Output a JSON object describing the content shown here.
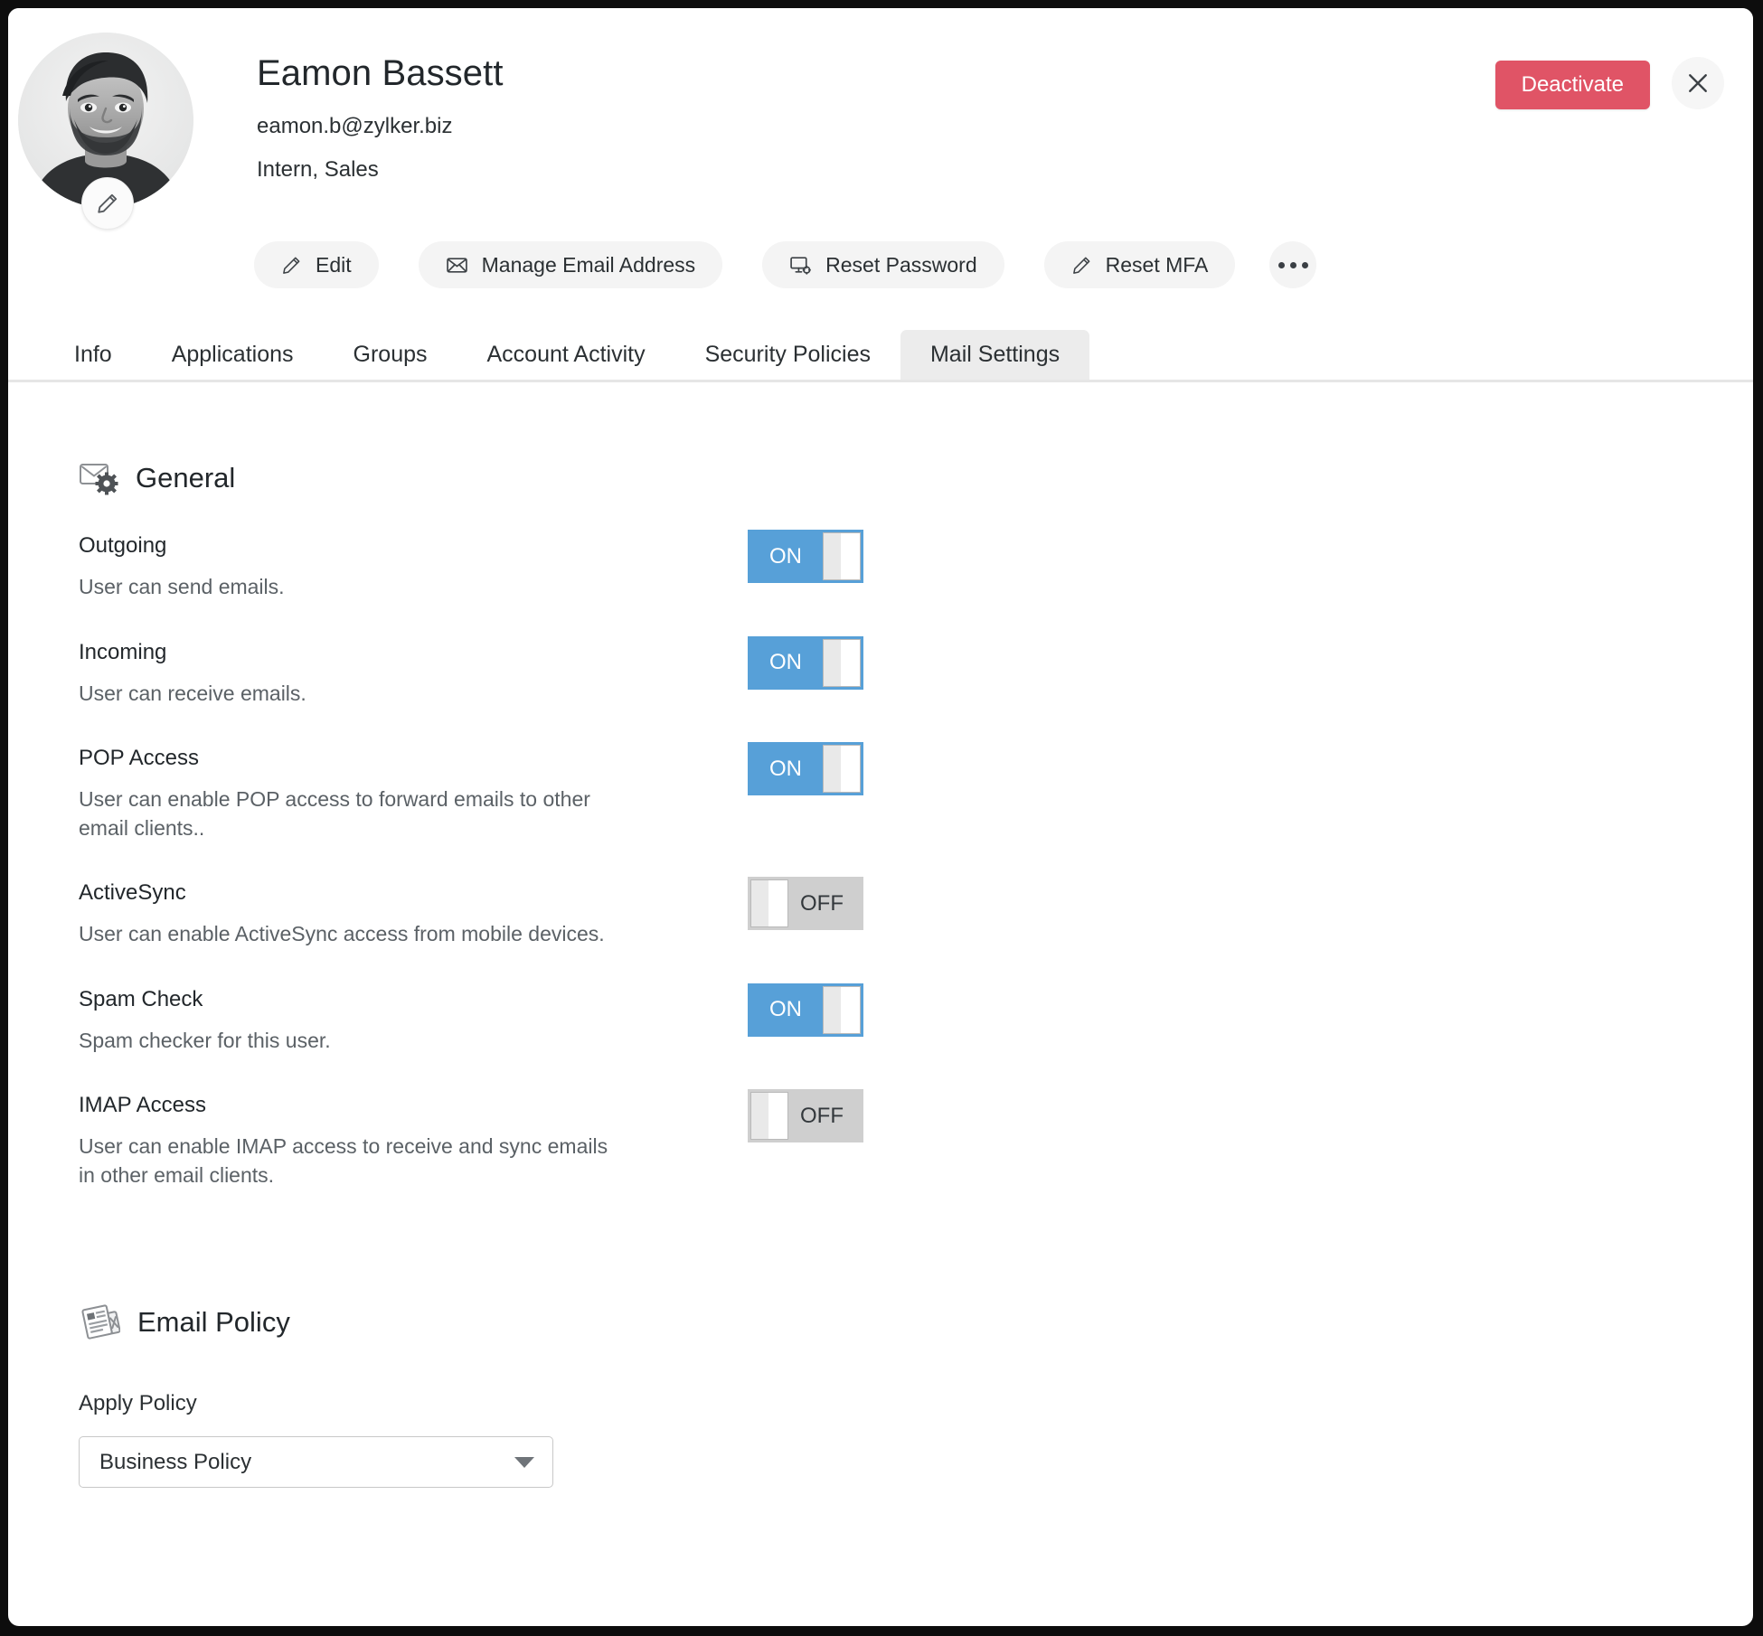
{
  "header": {
    "user_name": "Eamon Bassett",
    "user_email": "eamon.b@zylker.biz",
    "user_role": "Intern, Sales",
    "avatar_alt": "user-photo",
    "avatar_edit_icon": "pencil-icon",
    "deactivate_label": "Deactivate",
    "deactivate_color": "#e05466",
    "close_icon": "close-icon",
    "actions": [
      {
        "label": "Edit",
        "icon": "pencil-icon"
      },
      {
        "label": "Manage Email Address",
        "icon": "envelope-icon"
      },
      {
        "label": "Reset Password",
        "icon": "monitor-gear-icon"
      },
      {
        "label": "Reset MFA",
        "icon": "pencil-icon"
      }
    ],
    "more_icon": "more-horizontal-icon"
  },
  "tabs": [
    {
      "label": "Info",
      "active": false
    },
    {
      "label": "Applications",
      "active": false
    },
    {
      "label": "Groups",
      "active": false
    },
    {
      "label": "Account Activity",
      "active": false
    },
    {
      "label": "Security Policies",
      "active": false
    },
    {
      "label": "Mail Settings",
      "active": true
    }
  ],
  "general": {
    "title": "General",
    "icon": "envelope-gear-icon",
    "settings": [
      {
        "name": "Outgoing",
        "description": "User can send emails.",
        "state": "ON"
      },
      {
        "name": "Incoming",
        "description": "User can receive emails.",
        "state": "ON"
      },
      {
        "name": "POP Access",
        "description": "User can enable POP access to forward emails to other email clients..",
        "state": "ON"
      },
      {
        "name": "ActiveSync",
        "description": "User can enable ActiveSync access from mobile devices.",
        "state": "OFF"
      },
      {
        "name": "Spam Check",
        "description": "Spam checker for this user.",
        "state": "ON"
      },
      {
        "name": "IMAP Access",
        "description": "User can enable IMAP access to receive and sync emails in other email clients.",
        "state": "OFF"
      }
    ]
  },
  "email_policy": {
    "title": "Email Policy",
    "icon": "policy-document-icon",
    "apply_policy_label": "Apply Policy",
    "selected_policy": "Business Policy"
  },
  "colors": {
    "toggle_on": "#57a0d8",
    "toggle_off": "#cfcfcf",
    "accent_danger": "#e05466",
    "active_tab_bg": "#ececec"
  }
}
